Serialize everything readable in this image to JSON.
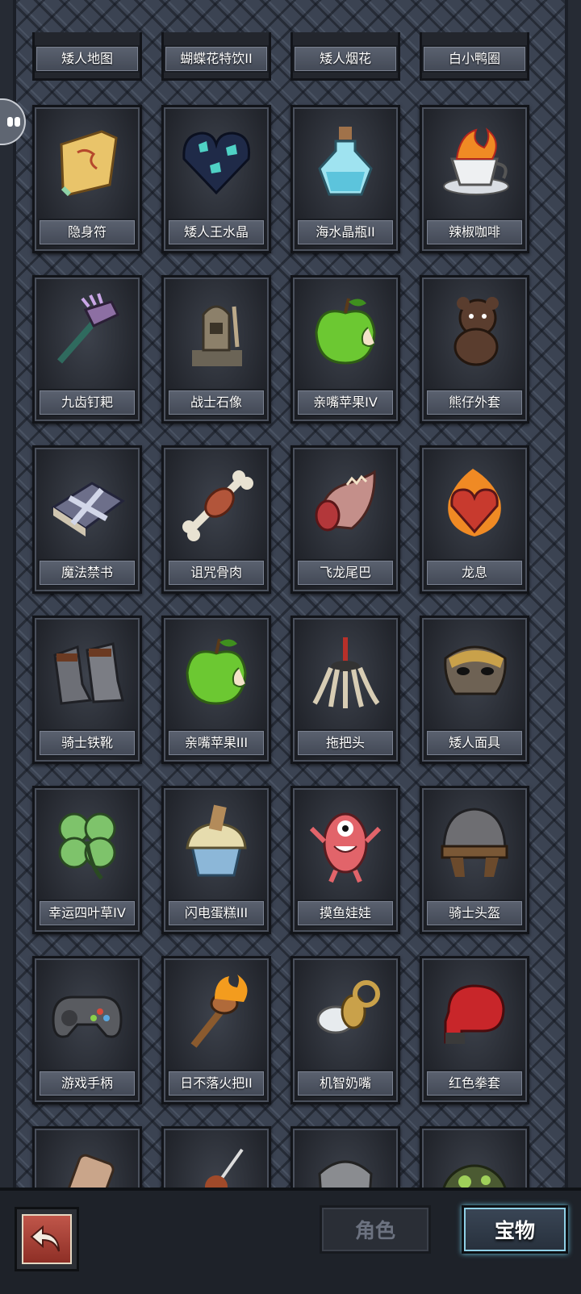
{
  "top_row": [
    "矮人地图",
    "蝴蝶花特饮II",
    "矮人烟花",
    "白小鸭圈"
  ],
  "items": [
    {
      "label": "隐身符",
      "icon": "scroll-icon"
    },
    {
      "label": "矮人王水晶",
      "icon": "crystal-heart-icon"
    },
    {
      "label": "海水晶瓶II",
      "icon": "potion-bottle-icon"
    },
    {
      "label": "辣椒咖啡",
      "icon": "coffee-cup-icon"
    },
    {
      "label": "九齿钉耙",
      "icon": "rake-icon"
    },
    {
      "label": "战士石像",
      "icon": "warrior-statue-icon"
    },
    {
      "label": "亲嘴苹果IV",
      "icon": "green-apple-icon"
    },
    {
      "label": "熊仔外套",
      "icon": "teddy-bear-icon"
    },
    {
      "label": "魔法禁书",
      "icon": "spell-book-icon"
    },
    {
      "label": "诅咒骨肉",
      "icon": "bone-meat-icon"
    },
    {
      "label": "飞龙尾巴",
      "icon": "dragon-tail-icon"
    },
    {
      "label": "龙息",
      "icon": "flaming-heart-icon"
    },
    {
      "label": "骑士铁靴",
      "icon": "iron-boots-icon"
    },
    {
      "label": "亲嘴苹果III",
      "icon": "green-apple-icon"
    },
    {
      "label": "拖把头",
      "icon": "mop-head-icon"
    },
    {
      "label": "矮人面具",
      "icon": "mask-icon"
    },
    {
      "label": "幸运四叶草IV",
      "icon": "clover-icon"
    },
    {
      "label": "闪电蛋糕III",
      "icon": "cupcake-icon"
    },
    {
      "label": "摸鱼娃娃",
      "icon": "pink-doll-icon"
    },
    {
      "label": "骑士头盔",
      "icon": "helmet-icon"
    },
    {
      "label": "游戏手柄",
      "icon": "gamepad-icon"
    },
    {
      "label": "日不落火把II",
      "icon": "torch-icon"
    },
    {
      "label": "机智奶嘴",
      "icon": "pacifier-icon"
    },
    {
      "label": "红色拳套",
      "icon": "boxing-glove-icon"
    }
  ],
  "partial_row_icons": [
    "bottle-icon",
    "skewer-icon",
    "armor-icon",
    "green-orb-icon"
  ],
  "tabs": {
    "role": "角色",
    "treasure": "宝物",
    "active": "宝物"
  },
  "colors": {
    "active_tab_glow": "#8fd0e6",
    "back_button": "#b5473c",
    "label_bg": "#4f5663"
  }
}
